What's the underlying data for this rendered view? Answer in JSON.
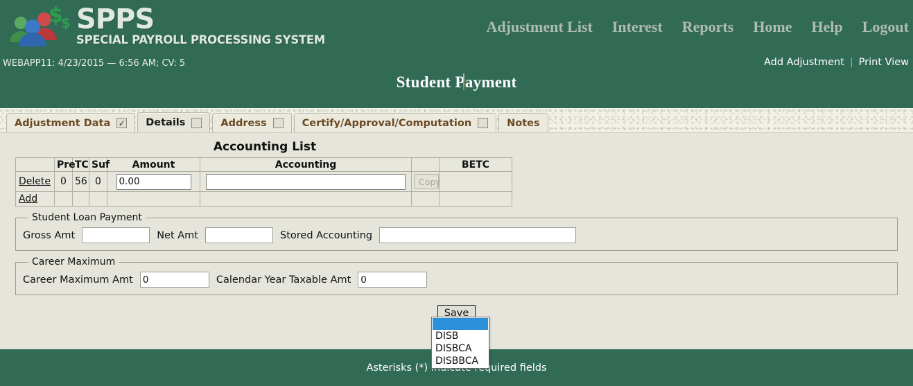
{
  "header": {
    "brand_title": "SPPS",
    "brand_subtitle": "SPECIAL PAYROLL PROCESSING SYSTEM",
    "env_line": "WEBAPP11: 4/23/2015 — 6:56 AM; CV: 5",
    "page_title": "Student Payment",
    "nav": [
      {
        "label": "Adjustment List"
      },
      {
        "label": "Interest"
      },
      {
        "label": "Reports"
      },
      {
        "label": "Home"
      },
      {
        "label": "Help"
      },
      {
        "label": "Logout"
      }
    ],
    "subnav": {
      "add_adjustment": "Add Adjustment",
      "separator": "|",
      "print_view": "Print View"
    }
  },
  "tabs": [
    {
      "label": "Adjustment Data",
      "has_checkbox": true,
      "check_glyph": "✓",
      "active": false
    },
    {
      "label": "Details",
      "has_checkbox": true,
      "check_glyph": "",
      "active": true
    },
    {
      "label": "Address",
      "has_checkbox": true,
      "check_glyph": "",
      "active": false
    },
    {
      "label": "Certify/Approval/Computation",
      "has_checkbox": true,
      "check_glyph": "",
      "active": false
    },
    {
      "label": "Notes",
      "has_checkbox": false,
      "check_glyph": "",
      "active": false
    }
  ],
  "accounting_list": {
    "title": "Accounting List",
    "columns": [
      "",
      "Pre",
      "TC",
      "Suf",
      "Amount",
      "Accounting",
      "",
      "BETC"
    ],
    "rows": [
      {
        "action": "Delete",
        "pre": "0",
        "tc": "56",
        "suf": "0",
        "amount": "0.00",
        "accounting": "",
        "copy_label": "Copy",
        "betc": ""
      }
    ],
    "add_label": "Add"
  },
  "betc_dropdown": {
    "open": true,
    "selected": "",
    "options": [
      "",
      "DISB",
      "DISBCA",
      "DISBBCA"
    ],
    "highlight_color": "#2b90d9"
  },
  "student_loan_payment": {
    "legend": "Student Loan Payment",
    "gross_amt_label": "Gross Amt",
    "gross_amt_value": "",
    "net_amt_label": "Net Amt",
    "net_amt_value": "",
    "stored_accounting_label": "Stored Accounting",
    "stored_accounting_value": ""
  },
  "career_maximum": {
    "legend": "Career Maximum",
    "career_max_label": "Career Maximum Amt",
    "career_max_value": "0",
    "calendar_year_label": "Calendar Year Taxable Amt",
    "calendar_year_value": "0"
  },
  "save_button_label": "Save",
  "footer_note": "Asterisks (*) indicate required fields",
  "colors": {
    "brand_green": "#316a55",
    "page_background": "#e6e5dc",
    "tab_label_brown": "#6b4a23",
    "dropdown_highlight": "#2b90d9"
  }
}
